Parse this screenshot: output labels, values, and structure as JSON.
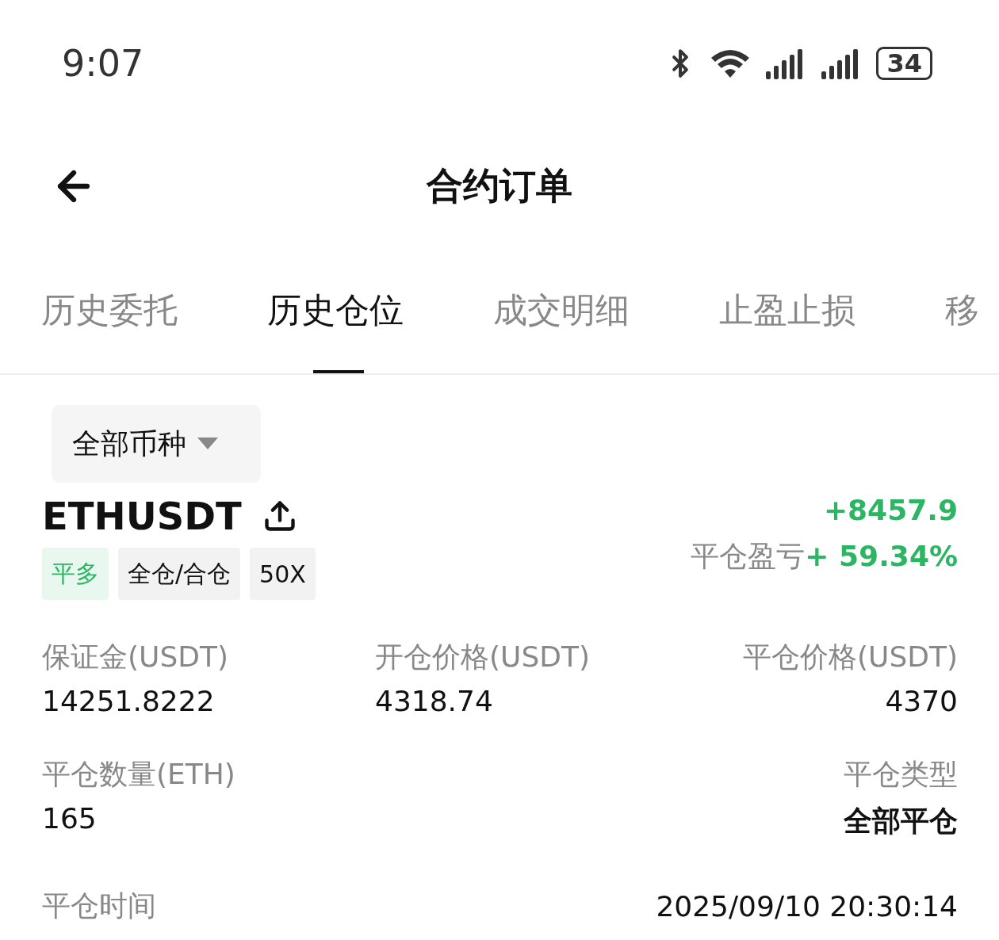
{
  "status_bar": {
    "time": "9:07",
    "battery": "34"
  },
  "header": {
    "title": "合约订单"
  },
  "tabs": [
    {
      "label": "历史委托",
      "selected": false
    },
    {
      "label": "历史仓位",
      "selected": true
    },
    {
      "label": "成交明细",
      "selected": false
    },
    {
      "label": "止盈止损",
      "selected": false
    },
    {
      "label": "移",
      "selected": false
    }
  ],
  "filter": {
    "label": "全部币种"
  },
  "position": {
    "symbol": "ETHUSDT",
    "pnl": "+8457.9",
    "pnl_label": "平仓盈亏",
    "pnl_percent": "+ 59.34%",
    "tags": [
      {
        "label": "平多",
        "kind": "side"
      },
      {
        "label": "全仓/合仓",
        "kind": "plain"
      },
      {
        "label": "50X",
        "kind": "plain"
      }
    ],
    "rows": [
      {
        "left": {
          "label": "保证金(USDT)",
          "value": "14251.8222"
        },
        "middle": {
          "label": "开仓价格(USDT)",
          "value": "4318.74"
        },
        "right": {
          "label": "平仓价格(USDT)",
          "value": "4370"
        }
      },
      {
        "left": {
          "label": "平仓数量(ETH)",
          "value": "165"
        },
        "right": {
          "label": "平仓类型",
          "value": "全部平仓"
        }
      }
    ],
    "close_time": {
      "label": "平仓时间",
      "value": "2025/09/10 20:30:14"
    }
  }
}
